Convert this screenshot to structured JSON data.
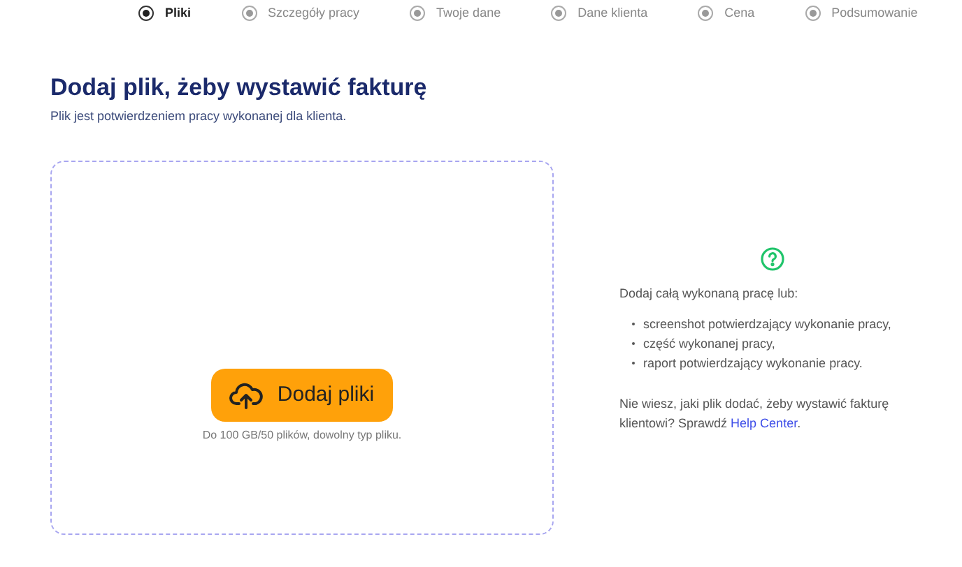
{
  "steps": [
    {
      "label": "Pliki",
      "selected": true
    },
    {
      "label": "Szczegóły pracy",
      "selected": false
    },
    {
      "label": "Twoje dane",
      "selected": false
    },
    {
      "label": "Dane klienta",
      "selected": false
    },
    {
      "label": "Cena",
      "selected": false
    },
    {
      "label": "Podsumowanie",
      "selected": false
    }
  ],
  "heading": "Dodaj plik, żeby wystawić fakturę",
  "subtitle": "Plik jest potwierdzeniem pracy wykonanej dla klienta.",
  "upload": {
    "button": "Dodaj pliki",
    "hint": "Do 100 GB/50 plików, dowolny typ pliku."
  },
  "help": {
    "intro": "Dodaj całą wykonaną pracę lub:",
    "items": [
      "screenshot potwierdzający wykonanie pracy,",
      "część wykonanej pracy,",
      "raport potwierdzający wykonanie pracy."
    ],
    "question": "Nie wiesz, jaki plik dodać, żeby wystawić fakturę klientowi? Sprawdź ",
    "link": "Help Center",
    "end": "."
  }
}
